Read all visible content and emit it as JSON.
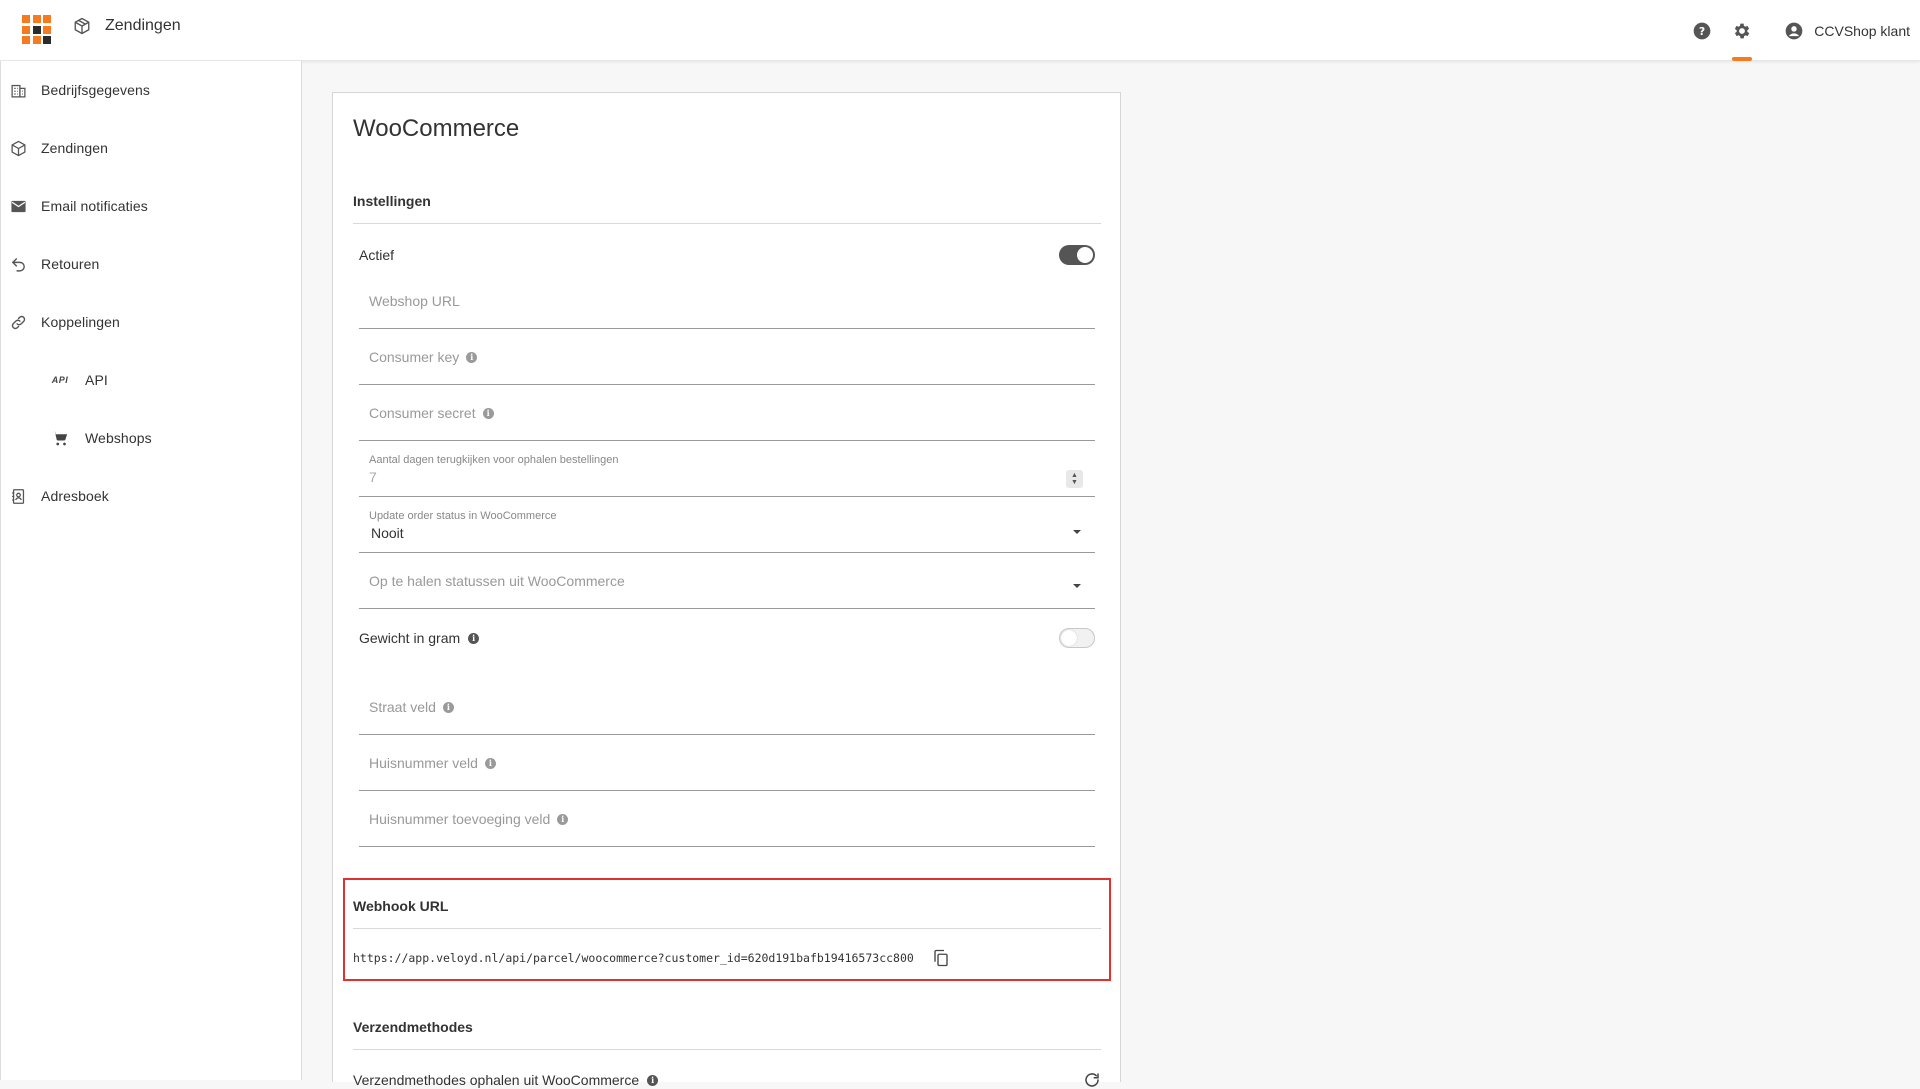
{
  "topbar": {
    "title": "Zendingen",
    "user": "CCVShop klant"
  },
  "sidebar": {
    "items": [
      {
        "label": "Bedrijfsgegevens",
        "icon": "building-icon"
      },
      {
        "label": "Zendingen",
        "icon": "package-icon"
      },
      {
        "label": "Email notificaties",
        "icon": "mail-icon"
      },
      {
        "label": "Retouren",
        "icon": "return-icon"
      },
      {
        "label": "Koppelingen",
        "icon": "link-icon"
      },
      {
        "label": "API",
        "icon": "api-icon",
        "icon_text": "API"
      },
      {
        "label": "Webshops",
        "icon": "cart-icon"
      },
      {
        "label": "Adresboek",
        "icon": "address-book-icon"
      }
    ]
  },
  "card": {
    "title": "WooCommerce",
    "settings_heading": "Instellingen",
    "active_label": "Actief",
    "webshop_url_placeholder": "Webshop URL",
    "consumer_key_placeholder": "Consumer key",
    "consumer_secret_placeholder": "Consumer secret",
    "days_label": "Aantal dagen terugkijken voor ophalen bestellingen",
    "days_value": "7",
    "update_status_label": "Update order status in WooCommerce",
    "update_status_value": "Nooit",
    "fetch_status_placeholder": "Op te halen statussen uit WooCommerce",
    "weight_label": "Gewicht in gram",
    "street_placeholder": "Straat veld",
    "housenumber_placeholder": "Huisnummer veld",
    "housenumber_addition_placeholder": "Huisnummer toevoeging veld",
    "webhook_heading": "Webhook URL",
    "webhook_url": "https://app.veloyd.nl/api/parcel/woocommerce?customer_id=620d191bafb19416573cc800",
    "shipping_heading": "Verzendmethodes",
    "shipping_fetch_label": "Verzendmethodes ophalen uit WooCommerce"
  },
  "colors": {
    "accent": "#f47b20",
    "highlight": "#e03030"
  }
}
